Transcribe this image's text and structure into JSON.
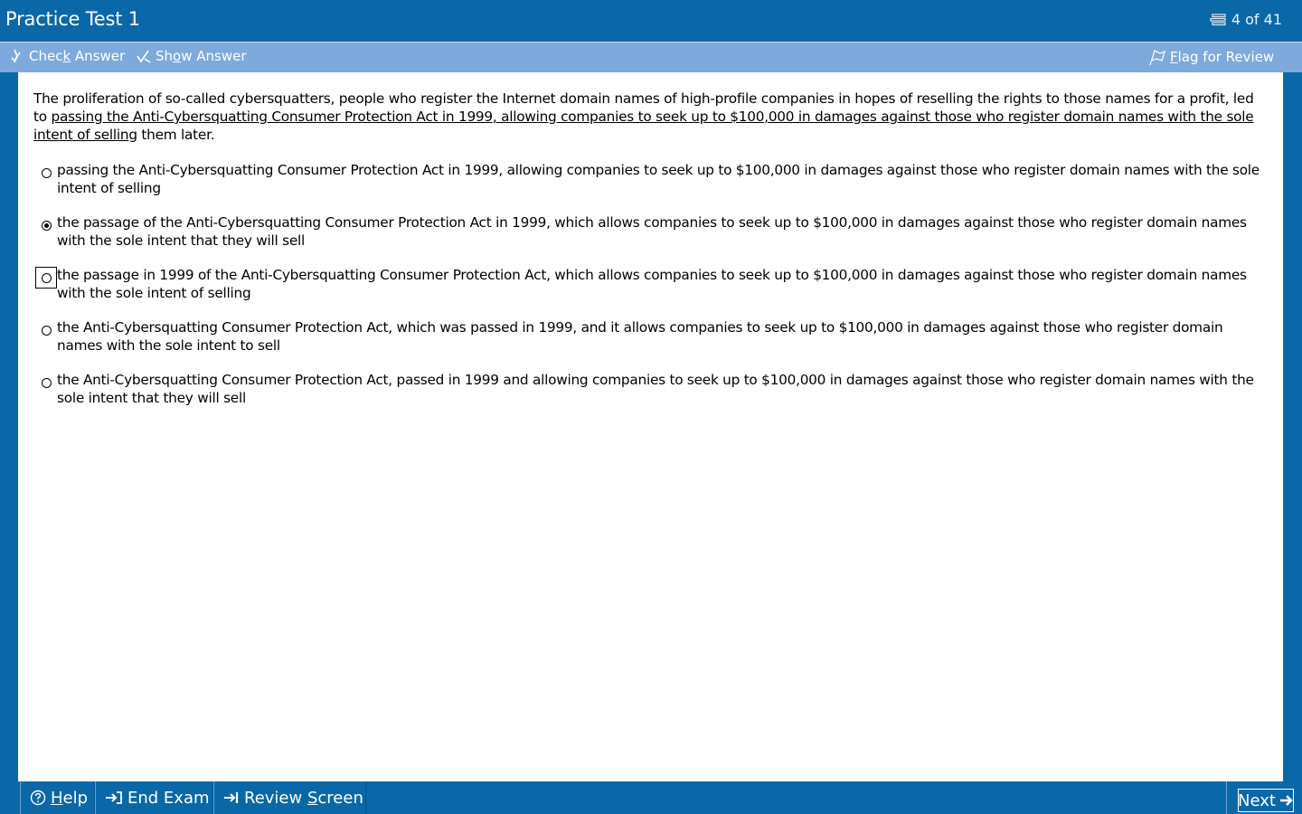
{
  "window": {
    "title": "Practice Test 1",
    "counter": "4 of 41"
  },
  "toolbar": {
    "check_answer": {
      "pre": "Chec",
      "key": "k",
      "post": " Answer"
    },
    "show_answer": {
      "pre": "Sh",
      "key": "o",
      "post": "w Answer"
    },
    "flag_review": {
      "key": "F",
      "post": "lag for Review"
    }
  },
  "question": {
    "stem_before": "The proliferation of so-called cybersquatters, people who register the Internet domain names of high-profile companies in hopes of reselling the rights to those names for a profit, led to ",
    "stem_underlined": "passing the Anti-Cybersquatting Consumer Protection Act in 1999, allowing companies to seek up to $100,000 in damages against those who register domain names with the sole intent of selling",
    "stem_after": " them later.",
    "options": [
      {
        "text": "passing the Anti-Cybersquatting Consumer Protection Act in 1999, allowing companies to seek up to $100,000 in damages against those who register domain names with the sole intent of selling",
        "selected": false
      },
      {
        "text": "the passage of the Anti-Cybersquatting Consumer Protection Act in 1999, which allows companies to seek up to $100,000 in damages against those who register domain names with the sole intent that they will sell",
        "selected": true
      },
      {
        "text": "the passage in 1999 of the Anti-Cybersquatting Consumer Protection Act, which allows companies to seek up to $100,000 in damages against those who register domain names with the sole intent of selling",
        "selected": false,
        "focused": true
      },
      {
        "text": "the Anti-Cybersquatting Consumer Protection Act, which was passed in 1999, and it allows companies to seek up to $100,000 in damages against those who register domain names with the sole intent to sell",
        "selected": false
      },
      {
        "text": "the Anti-Cybersquatting Consumer Protection Act, passed in 1999 and allowing companies to seek up to $100,000 in damages against those who register domain names with the sole intent that they will sell",
        "selected": false
      }
    ]
  },
  "bottombar": {
    "help": {
      "key": "H",
      "post": "elp"
    },
    "end_exam": {
      "text": "End Exam"
    },
    "review_screen": {
      "pre": "Review ",
      "key": "S",
      "post": "creen"
    },
    "next": {
      "key": "N",
      "post": "ext"
    }
  },
  "colors": {
    "frame": "#0a68a8",
    "toolbar": "#7ea9dc",
    "content_bg": "#ffffff"
  },
  "icons": {
    "counter": "question-list-icon",
    "check_answer": "check-answer-icon",
    "show_answer": "show-answer-icon",
    "flag_review": "flag-icon",
    "help": "help-circle-icon",
    "end_exam": "end-exam-icon",
    "review_screen": "review-screen-icon",
    "next": "arrow-right-icon"
  }
}
